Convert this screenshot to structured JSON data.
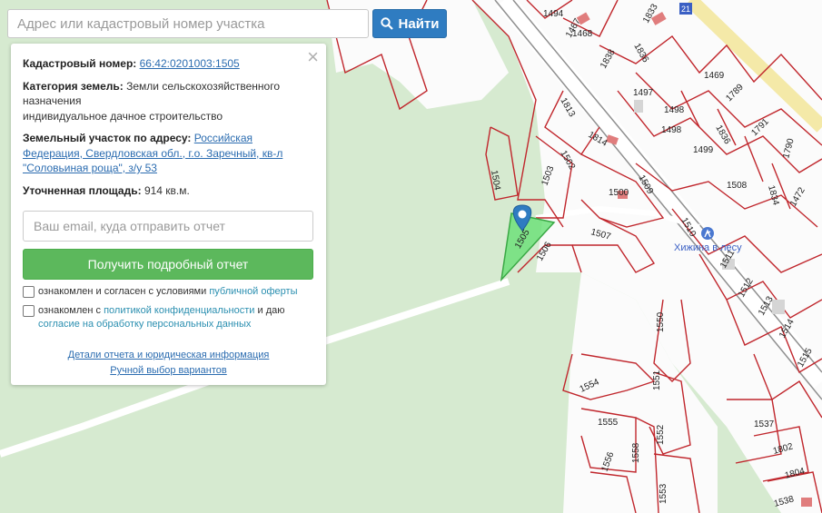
{
  "search": {
    "placeholder": "Адрес или кадастровый номер участка",
    "button_label": "Найти",
    "button_icon": "search-icon"
  },
  "panel": {
    "close_icon": "close-icon",
    "cadastral_label": "Кадастровый номер:",
    "cadastral_value": "66:42:0201003:1505",
    "category_label": "Категория земель:",
    "category_value": "Земли сельскохозяйственного назначения",
    "category_use": "индивидуальное дачное строительство",
    "address_label": "Земельный участок по адресу:",
    "address_value": "Российская Федерация, Свердловская обл., г.о. Заречный, кв-л \"Соловьиная роща\", з/у 53",
    "area_label": "Уточненная площадь:",
    "area_value": "914 кв.м.",
    "email_placeholder": "Ваш email, куда отправить отчет",
    "report_button": "Получить подробный отчет",
    "consent1_text": "ознакомлен и согласен с условиями ",
    "consent1_link": "публичной оферты",
    "consent2_text": "ознакомлен с ",
    "consent2_link": "политикой конфиденциальности",
    "consent2_mid": " и даю",
    "consent2_link2": "согласие на обработку персональных данных",
    "footer_link1": "Детали отчета и юридическая информация",
    "footer_link2": "Ручной выбор вариантов"
  },
  "map": {
    "poi_label": "Хижина в лесу",
    "selected_parcel": "1505",
    "parcel_labels": [
      "1494",
      "1467",
      "1833",
      "1468",
      "1836",
      "1838",
      "1469",
      "1497",
      "1789",
      "1498",
      "1836",
      "1791",
      "1813",
      "1814",
      "1498",
      "1499",
      "1790",
      "1502",
      "1834",
      "1504",
      "1503",
      "1509",
      "1500",
      "1508",
      "1472",
      "1510",
      "1507",
      "1506",
      "1511",
      "1512",
      "1513",
      "1514",
      "1515",
      "1550",
      "1551",
      "1554",
      "1537",
      "1555",
      "1552",
      "1802",
      "1558",
      "1556",
      "1804",
      "1553",
      "1538"
    ],
    "colors": {
      "parcel_border": "#c0262c",
      "selected_fill": "#6fe07a",
      "map_bg": "#d6ead0",
      "road": "#ffffff"
    }
  }
}
